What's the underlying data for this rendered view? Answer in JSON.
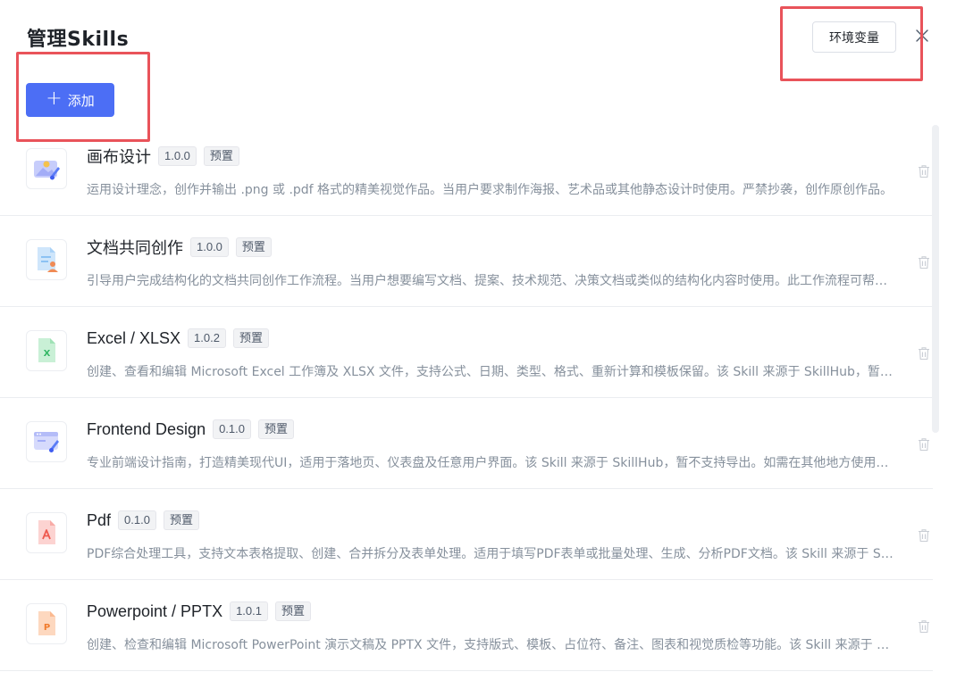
{
  "header": {
    "title": "管理Skills",
    "env_button": "环境变量",
    "add_button": "添加",
    "add_icon": "+"
  },
  "colors": {
    "primary": "#4c6ef5",
    "highlight": "#e9535a"
  },
  "skills": [
    {
      "name": "画布设计",
      "version": "1.0.0",
      "tag": "预置",
      "icon": "canvas-design-icon",
      "description": "运用设计理念，创作并输出 .png 或 .pdf 格式的精美视觉作品。当用户要求制作海报、艺术品或其他静态设计时使用。严禁抄袭，创作原创作品。"
    },
    {
      "name": "文档共同创作",
      "version": "1.0.0",
      "tag": "预置",
      "icon": "doc-coauthoring-icon",
      "description": "引导用户完成结构化的文档共同创作工作流程。当用户想要编写文档、提案、技术规范、决策文档或类似的结构化内容时使用。此工作流程可帮助用户高效完成。"
    },
    {
      "name": "Excel / XLSX",
      "version": "1.0.2",
      "tag": "预置",
      "icon": "excel-icon",
      "description": "创建、查看和编辑 Microsoft Excel 工作簿及 XLSX 文件，支持公式、日期、类型、格式、重新计算和模板保留。该 Skill 来源于 SkillHub，暂不支持导出。"
    },
    {
      "name": "Frontend Design",
      "version": "0.1.0",
      "tag": "预置",
      "icon": "frontend-design-icon",
      "description": "专业前端设计指南，打造精美现代UI，适用于落地页、仪表盘及任意用户界面。该 Skill 来源于 SkillHub，暂不支持导出。如需在其他地方使用请前往。"
    },
    {
      "name": "Pdf",
      "version": "0.1.0",
      "tag": "预置",
      "icon": "pdf-icon",
      "description": "PDF综合处理工具，支持文本表格提取、创建、合并拆分及表单处理。适用于填写PDF表单或批量处理、生成、分析PDF文档。该 Skill 来源于 SkillHub。"
    },
    {
      "name": "Powerpoint / PPTX",
      "version": "1.0.1",
      "tag": "预置",
      "icon": "pptx-icon",
      "description": "创建、检查和编辑 Microsoft PowerPoint 演示文稿及 PPTX 文件，支持版式、模板、占位符、备注、图表和视觉质检等功能。该 Skill 来源于 SkillHub。"
    }
  ]
}
